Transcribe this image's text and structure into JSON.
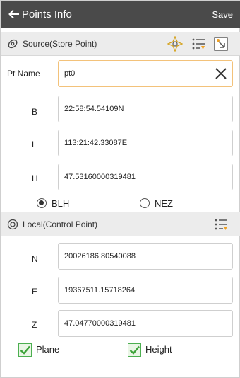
{
  "header": {
    "title": "Points Info",
    "save_label": "Save"
  },
  "source": {
    "title": "Source(Store Point)",
    "tools": [
      "locate-icon",
      "list-icon",
      "map-pick-icon"
    ],
    "pt_name_label": "Pt Name",
    "pt_name_value": "pt0",
    "fields": [
      {
        "label": "B",
        "value": "22:58:54.54109N"
      },
      {
        "label": "L",
        "value": "113:21:42.33087E"
      },
      {
        "label": "H",
        "value": "47.53160000319481"
      }
    ],
    "coord_options": [
      {
        "label": "BLH",
        "selected": true
      },
      {
        "label": "NEZ",
        "selected": false
      }
    ]
  },
  "local": {
    "title": "Local(Control Point)",
    "tools": [
      "list-icon"
    ],
    "fields": [
      {
        "label": "N",
        "value": "20026186.80540088"
      },
      {
        "label": "E",
        "value": "19367511.15718264"
      },
      {
        "label": "Z",
        "value": "47.04770000319481"
      }
    ],
    "checks": [
      {
        "label": "Plane",
        "checked": true
      },
      {
        "label": "Height",
        "checked": true
      }
    ]
  },
  "colors": {
    "appbar": "#4a4a4a",
    "section": "#ececec",
    "active_border": "#f3c27a",
    "check": "#4caf50"
  }
}
